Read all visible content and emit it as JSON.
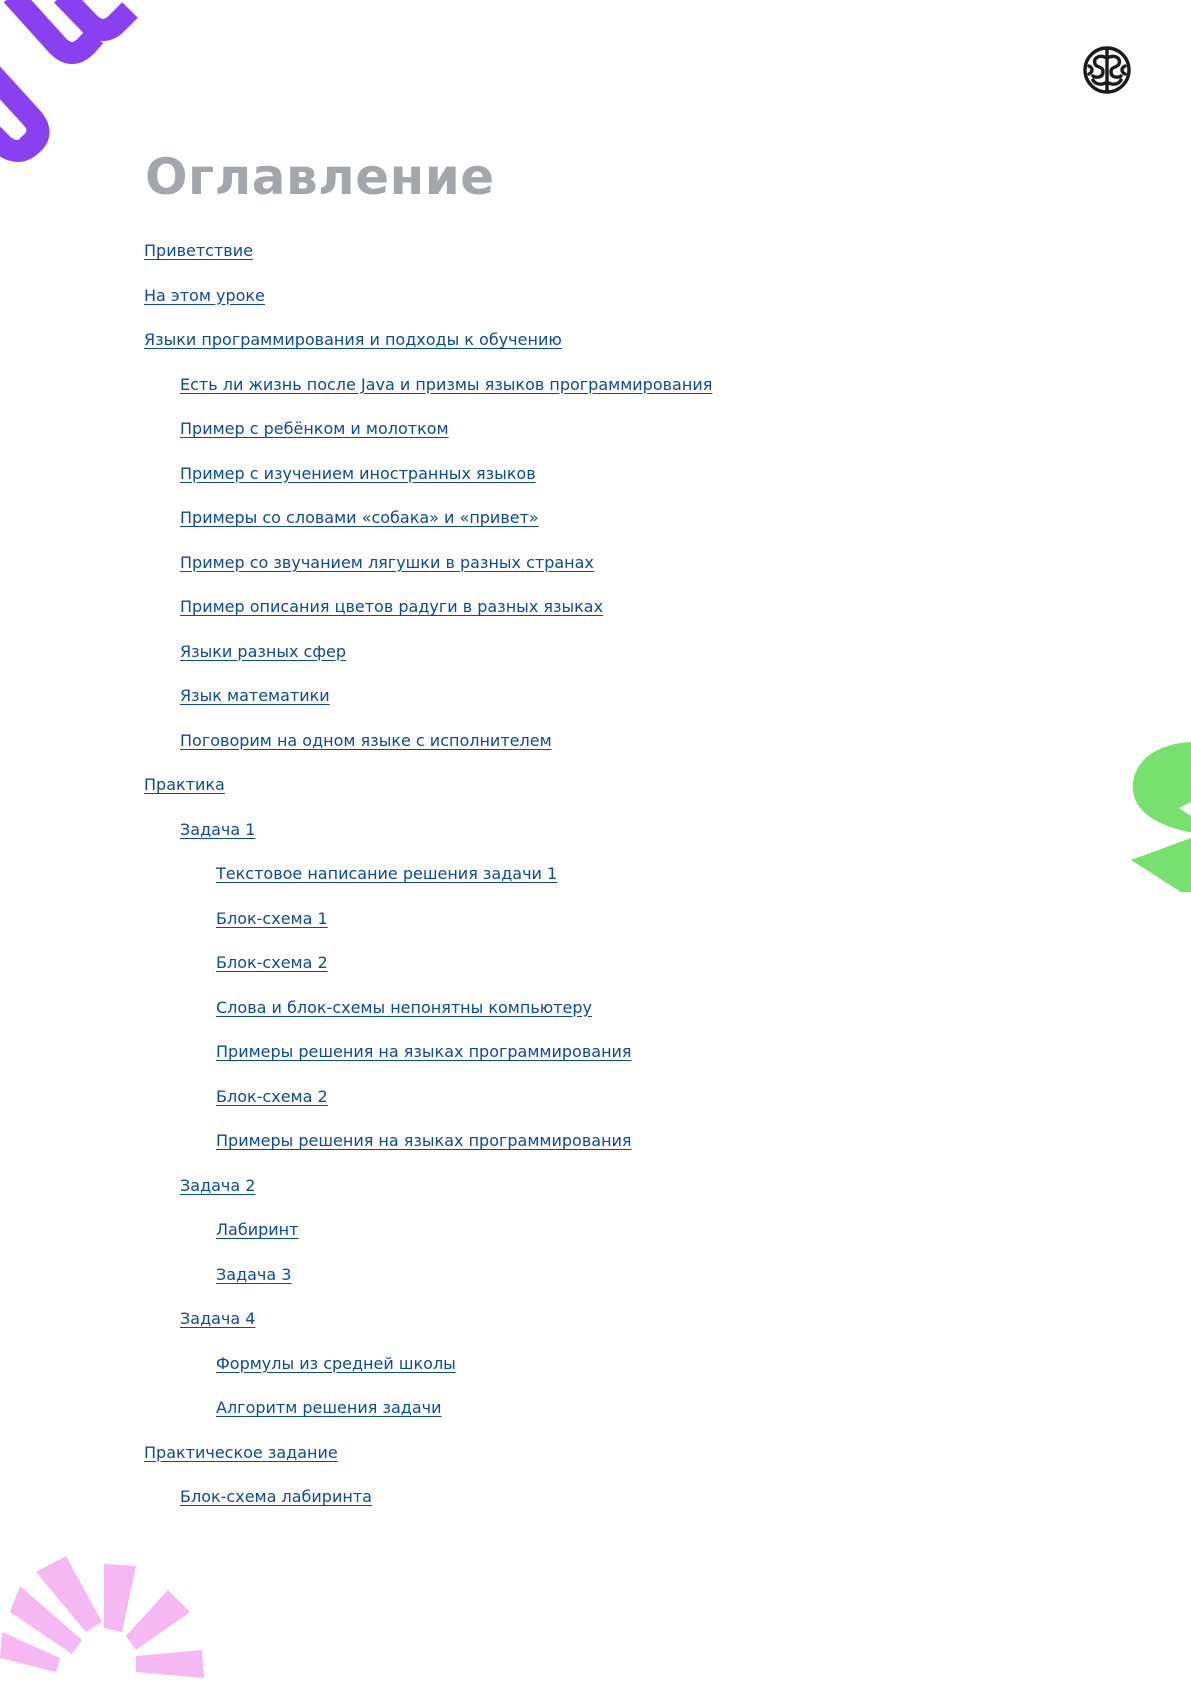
{
  "page": {
    "title": "Оглавление"
  },
  "colors": {
    "title": "#a3a6ab",
    "link": "#0b49a6",
    "accent_purple": "#8a3ff0",
    "accent_green": "#76e26d",
    "accent_pink": "#f5b8f2",
    "logo": "#1b1b1b"
  },
  "icons": {
    "logo": "brain-icon",
    "decorations": [
      "purple-stripes-decoration",
      "green-shape-decoration",
      "pink-burst-decoration"
    ]
  },
  "toc": [
    {
      "label": "Приветствие",
      "level": 1
    },
    {
      "label": "На этом уроке",
      "level": 1
    },
    {
      "label": "Языки программирования и подходы к обучению",
      "level": 1
    },
    {
      "label": "Есть ли жизнь после Java и призмы языков программирования",
      "level": 2
    },
    {
      "label": "Пример с ребёнком и молотком",
      "level": 2
    },
    {
      "label": "Пример с изучением иностранных языков",
      "level": 2
    },
    {
      "label": "Примеры со словами «собака» и «привет»",
      "level": 2
    },
    {
      "label": "Пример со звучанием лягушки в разных странах",
      "level": 2
    },
    {
      "label": "Пример описания цветов радуги в разных языках",
      "level": 2
    },
    {
      "label": "Языки разных сфер",
      "level": 2
    },
    {
      "label": "Язык математики",
      "level": 2
    },
    {
      "label": "Поговорим на одном языке с исполнителем",
      "level": 2
    },
    {
      "label": "Практика",
      "level": 1
    },
    {
      "label": "Задача 1",
      "level": 2
    },
    {
      "label": "Текстовое написание решения задачи 1",
      "level": 3
    },
    {
      "label": "Блок-схема 1",
      "level": 3
    },
    {
      "label": "Блок-схема 2",
      "level": 3
    },
    {
      "label": "Слова и блок-схемы непонятны компьютеру",
      "level": 3
    },
    {
      "label": "Примеры решения на языках программирования",
      "level": 3
    },
    {
      "label": "Блок-схема 2",
      "level": 3
    },
    {
      "label": "Примеры решения на языках программирования",
      "level": 3
    },
    {
      "label": "Задача 2",
      "level": 2
    },
    {
      "label": "Лабиринт",
      "level": 3
    },
    {
      "label": "Задача 3",
      "level": 3
    },
    {
      "label": "Задача 4",
      "level": 2
    },
    {
      "label": "Формулы из средней школы",
      "level": 3
    },
    {
      "label": "Алгоритм решения задачи",
      "level": 3
    },
    {
      "label": "Практическое задание",
      "level": 1
    },
    {
      "label": "Блок-схема лабиринта",
      "level": 2
    }
  ]
}
